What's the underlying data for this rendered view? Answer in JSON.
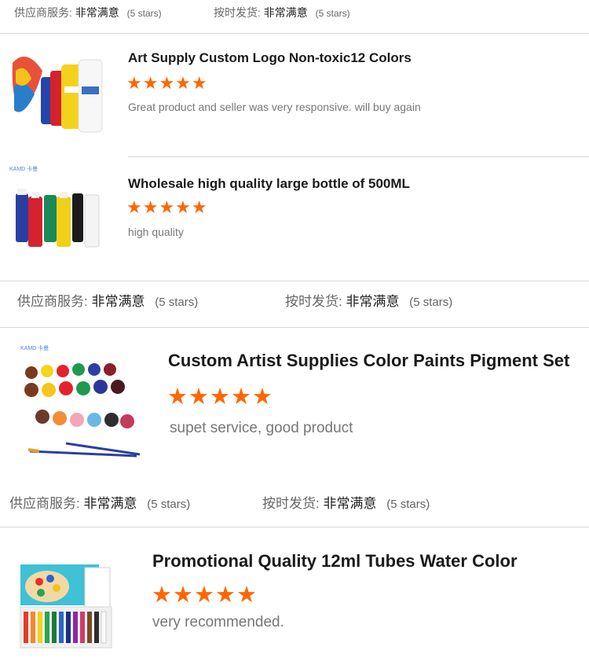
{
  "top_rating": {
    "supplier_label": "供应商服务:",
    "supplier_value": "非常满意",
    "supplier_count": "(5 stars)",
    "delivery_label": "按时发货:",
    "delivery_value": "非常满意",
    "delivery_count": "(5 stars)"
  },
  "reviews": [
    {
      "title": "Art Supply Custom Logo Non-toxic12 Colors",
      "stars": "★★★★★",
      "rating": 5,
      "comment": "Great product and seller was very responsive. will buy again"
    },
    {
      "title": "Wholesale high quality large bottle of 500ML",
      "stars": "★★★★★",
      "rating": 5,
      "comment": "high quality",
      "brand": "KAMD 卡曼"
    },
    {
      "title": "Custom Artist Supplies Color Paints Pigment Set",
      "stars": "★★★★★",
      "rating": 5,
      "comment": "supet service, good product",
      "brand": "KAMD 卡曼"
    },
    {
      "title": "Promotional Quality 12ml Tubes Water Color",
      "stars": "★★★★★",
      "rating": 5,
      "comment": "very recommended."
    }
  ],
  "mid_rating": {
    "supplier_label": "供应商服务:",
    "supplier_value": "非常满意",
    "supplier_count": "(5 stars)",
    "delivery_label": "按时发货:",
    "delivery_value": "非常满意",
    "delivery_count": "(5 stars)"
  },
  "low_rating": {
    "supplier_label": "供应商服务:",
    "supplier_value": "非常满意",
    "supplier_count": "(5 stars)",
    "delivery_label": "按时发货:",
    "delivery_value": "非常满意",
    "delivery_count": "(5 stars)"
  },
  "colors": {
    "star": "#ff6600",
    "divider": "#d8d8d8"
  }
}
